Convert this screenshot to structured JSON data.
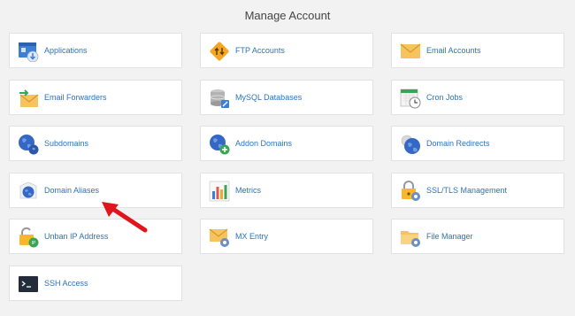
{
  "page": {
    "title": "Manage Account"
  },
  "cards": {
    "applications": "Applications",
    "ftp_accounts": "FTP Accounts",
    "email_accounts": "Email Accounts",
    "email_forwarders": "Email Forwarders",
    "mysql_databases": "MySQL Databases",
    "cron_jobs": "Cron Jobs",
    "subdomains": "Subdomains",
    "addon_domains": "Addon Domains",
    "domain_redirects": "Domain Redirects",
    "domain_aliases": "Domain Aliases",
    "metrics": "Metrics",
    "ssl_tls_management": "SSL/TLS Management",
    "unban_ip_address": "Unban IP Address",
    "mx_entry": "MX Entry",
    "file_manager": "File Manager",
    "ssh_access": "SSH Access"
  },
  "icons": {
    "applications": "applications-icon",
    "ftp_accounts": "ftp-icon",
    "email_accounts": "envelope-icon",
    "email_forwarders": "email-forward-icon",
    "mysql_databases": "database-icon",
    "cron_jobs": "calendar-clock-icon",
    "subdomains": "globe-icon",
    "addon_domains": "globe-add-icon",
    "domain_redirects": "globe-redirect-icon",
    "domain_aliases": "globe-alias-icon",
    "metrics": "bar-chart-icon",
    "ssl_tls_management": "lock-gear-icon",
    "unban_ip_address": "unlock-ip-icon",
    "mx_entry": "envelope-gear-icon",
    "file_manager": "folder-gear-icon",
    "ssh_access": "terminal-icon"
  },
  "colors": {
    "link": "#2d73b9",
    "annotation_arrow": "#e0161c",
    "card_background": "#ffffff",
    "page_background": "#f2f2f2"
  }
}
